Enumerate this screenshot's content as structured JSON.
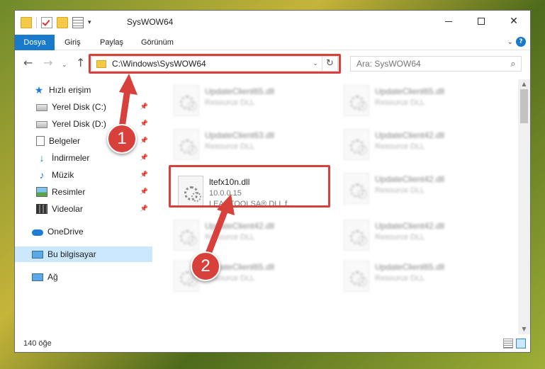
{
  "window": {
    "title": "SysWOW64"
  },
  "ribbon": {
    "tabs": [
      "Dosya",
      "Giriş",
      "Paylaş",
      "Görünüm"
    ]
  },
  "address": {
    "path": "C:\\Windows\\SysWOW64"
  },
  "search": {
    "placeholder": "Ara: SysWOW64"
  },
  "sidebar": {
    "items": [
      {
        "label": "Hızlı erişim",
        "icon": "star-icon"
      },
      {
        "label": "Yerel Disk (C:)",
        "icon": "disk-icon",
        "pinned": true
      },
      {
        "label": "Yerel Disk (D:)",
        "icon": "disk-icon",
        "pinned": true
      },
      {
        "label": "Belgeler",
        "icon": "document-icon",
        "pinned": true
      },
      {
        "label": "İndirmeler",
        "icon": "download-icon",
        "pinned": true
      },
      {
        "label": "Müzik",
        "icon": "music-icon",
        "pinned": true
      },
      {
        "label": "Resimler",
        "icon": "pictures-icon",
        "pinned": true
      },
      {
        "label": "Videolar",
        "icon": "videos-icon",
        "pinned": true
      },
      {
        "label": "OneDrive",
        "icon": "cloud-icon"
      },
      {
        "label": "Bu bilgisayar",
        "icon": "computer-icon",
        "selected": true
      },
      {
        "label": "Ağ",
        "icon": "network-icon"
      }
    ]
  },
  "files": [
    {
      "name": "UpdateClient65.dll",
      "type": "Resource DLL"
    },
    {
      "name": "UpdateClient65.dll",
      "type": "Resource DLL"
    },
    {
      "name": "UpdateClient63.dll",
      "type": "Resource DLL"
    },
    {
      "name": "UpdateClient42.dll",
      "type": "Resource DLL"
    },
    {
      "name": "ltefx10n.dll",
      "version": "10.0.0.15",
      "type": "LEADTOOLSA® DLL f..."
    },
    {
      "name": "UpdateClient42.dll",
      "type": "Resource DLL"
    },
    {
      "name": "UpdateClient42.dll",
      "type": "Resource DLL"
    },
    {
      "name": "UpdateClient42.dll",
      "type": "Resource DLL"
    },
    {
      "name": "UpdateClient65.dll",
      "type": "Resource DLL"
    },
    {
      "name": "UpdateClient65.dll",
      "type": "Resource DLL"
    }
  ],
  "status": {
    "count": "140 öğe"
  },
  "annotations": {
    "step1": "1",
    "step2": "2",
    "color": "#d8403c"
  }
}
